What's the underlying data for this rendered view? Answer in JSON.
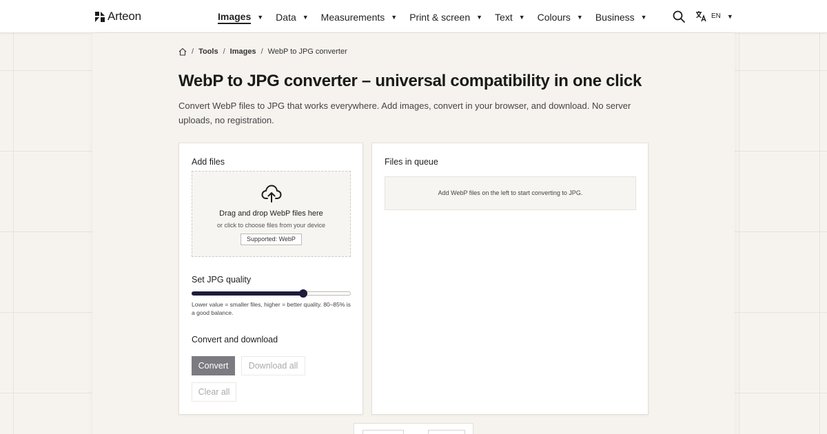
{
  "header": {
    "logo_text": "Arteon",
    "nav": [
      {
        "label": "Images",
        "active": true
      },
      {
        "label": "Data"
      },
      {
        "label": "Measurements"
      },
      {
        "label": "Print & screen"
      },
      {
        "label": "Text"
      },
      {
        "label": "Colours"
      },
      {
        "label": "Business"
      }
    ],
    "caret": "▼",
    "language": "EN"
  },
  "breadcrumb": {
    "separator": "/",
    "items": [
      "Tools",
      "Images",
      "WebP to JPG converter"
    ]
  },
  "page": {
    "title": "WebP to JPG converter – universal compatibility in one click",
    "subtitle": "Convert WebP files to JPG that works everywhere. Add images, convert in your browser, and download. No server uploads, no registration."
  },
  "add_files": {
    "title": "Add files",
    "drop_title": "Drag and drop WebP files here",
    "drop_sub": "or click to choose files from your device",
    "supported": "Supported: WebP"
  },
  "quality": {
    "title": "Set JPG quality",
    "value_fraction": 0.7,
    "hint": "Lower value = smaller files, higher = better quality. 80–85% is a good balance."
  },
  "actions": {
    "title": "Convert and download",
    "convert": "Convert",
    "download_all": "Download all",
    "clear_all": "Clear all"
  },
  "queue": {
    "title": "Files in queue",
    "empty": "Add WebP files on the left to start converting to JPG."
  },
  "colors": {
    "accent": "#1d1c3a",
    "convert_button": "#7c7b82",
    "background": "#f6f3ee"
  }
}
